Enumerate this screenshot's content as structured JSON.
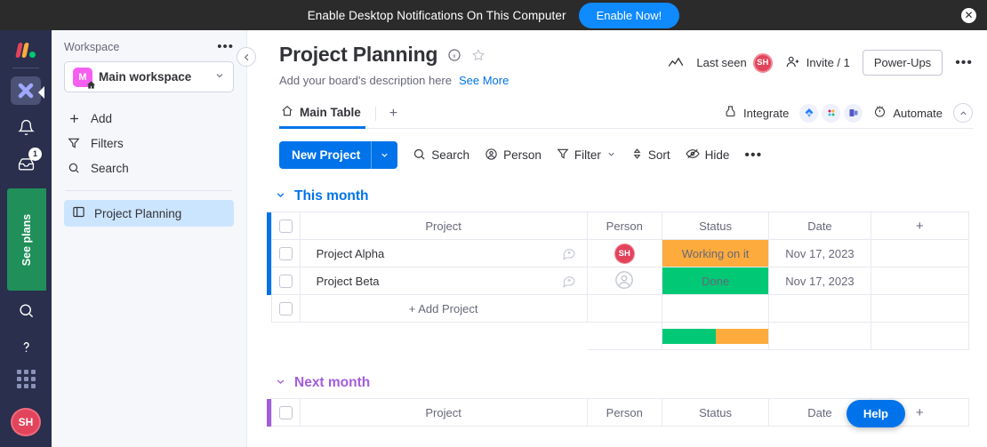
{
  "banner": {
    "text": "Enable Desktop Notifications On This Computer",
    "button_label": "Enable Now!",
    "close_label": "✕",
    "bg_color": "#2b2b2b",
    "button_color": "#0f8aff"
  },
  "rail": {
    "logo_name": "monday-logo",
    "items": [
      {
        "name": "app-switcher",
        "label": "",
        "active": true
      },
      {
        "name": "notifications",
        "label": "",
        "badge": ""
      },
      {
        "name": "inbox",
        "label": "",
        "badge": "1"
      },
      {
        "name": "my-work",
        "label": "",
        "badge": ""
      },
      {
        "name": "favorites",
        "label": "",
        "badge": ""
      },
      {
        "name": "invite-members",
        "label": "",
        "badge": ""
      },
      {
        "name": "search",
        "label": "",
        "badge": ""
      },
      {
        "name": "help",
        "label": "",
        "badge": ""
      }
    ],
    "see_plans_label": "See plans",
    "see_plans_color": "#208f5a",
    "avatar_initials": "SH",
    "avatar_color": "#e2445c"
  },
  "workspace": {
    "header_label": "Workspace",
    "more_label": "•••",
    "selected_name": "Main workspace",
    "selected_initial": "M",
    "avatar_color": "#f65ff0",
    "menu": [
      {
        "label": "Add",
        "icon": "plus-icon"
      },
      {
        "label": "Filters",
        "icon": "funnel-icon"
      },
      {
        "label": "Search",
        "icon": "search-icon"
      }
    ],
    "board_label": "Project Planning",
    "board_highlight": "#cce5ff"
  },
  "header": {
    "title": "Project Planning",
    "description": "Add your board's description here",
    "see_more": "See More",
    "last_seen_label": "Last seen",
    "last_seen_initials": "SH",
    "invite_label": "Invite / 1",
    "powerups_label": "Power-Ups",
    "more_label": "•••"
  },
  "tabs": {
    "items": [
      {
        "label": "Main Table",
        "active": true
      }
    ],
    "add_label": "+",
    "integrate_label": "Integrate",
    "automate_label": "Automate",
    "app_icons": [
      "jira-icon",
      "slack-icon",
      "teams-icon"
    ]
  },
  "toolbar": {
    "new_item_label": "New Project",
    "new_item_chevron": "⌄",
    "search_label": "Search",
    "person_label": "Person",
    "filter_label": "Filter",
    "filter_chevron": "⌄",
    "sort_label": "Sort",
    "hide_label": "Hide",
    "more_label": "•••"
  },
  "table": {
    "columns": [
      "Project",
      "Person",
      "Status",
      "Date"
    ],
    "add_column_label": "+",
    "add_row_label": "+ Add Project",
    "status_colors": {
      "working": "#fdab3d",
      "done": "#00c875"
    }
  },
  "groups": [
    {
      "title": "This month",
      "color": "#0073ea",
      "collapse_icon": "⌄",
      "rows": [
        {
          "project": "Project Alpha",
          "person_initials": "SH",
          "person_empty": false,
          "status": "Working on it",
          "status_color": "#fdab3d",
          "date": "Nov 17, 2023"
        },
        {
          "project": "Project Beta",
          "person_initials": "",
          "person_empty": true,
          "status": "Done",
          "status_color": "#00c875",
          "date": "Nov 17, 2023"
        }
      ],
      "summary": [
        {
          "label": "Done",
          "color": "#00c875",
          "percent": 50
        },
        {
          "label": "Working on it",
          "color": "#fdab3d",
          "percent": 50
        }
      ]
    },
    {
      "title": "Next month",
      "color": "#a25ddc",
      "collapse_icon": "⌄",
      "rows": [],
      "summary": []
    }
  ],
  "help": {
    "label": "Help",
    "color": "#0073ea"
  }
}
